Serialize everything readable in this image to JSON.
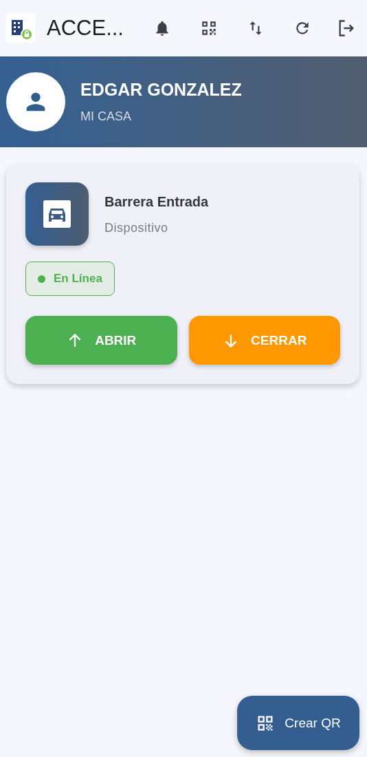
{
  "app_bar": {
    "title": "ACCE..."
  },
  "profile": {
    "name": "EDGAR GONZALEZ",
    "place": "MI CASA"
  },
  "devices": [
    {
      "name": "Barrera Entrada",
      "type": "Dispositivo",
      "status": {
        "label": "En Línea",
        "online": true
      },
      "actions": [
        {
          "kind": "open",
          "label": "ABRIR"
        },
        {
          "kind": "close",
          "label": "CERRAR"
        }
      ]
    }
  ],
  "fab": {
    "label": "Crear QR"
  }
}
